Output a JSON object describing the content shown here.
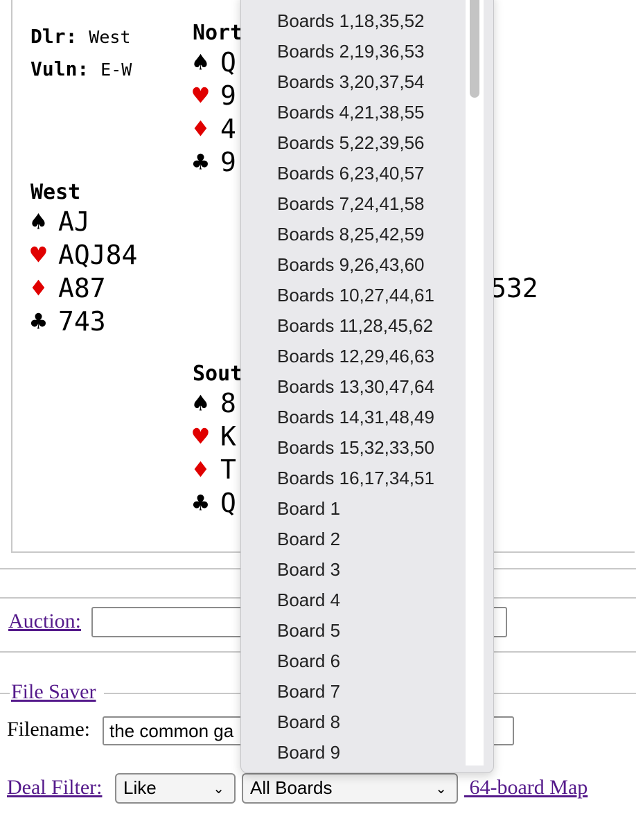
{
  "deal": {
    "dealer_label": "Dlr:",
    "dealer_value": "West",
    "vuln_label": "Vuln:",
    "vuln_value": "E-W",
    "north": {
      "name": "Nort",
      "spades": "Q",
      "hearts": "9",
      "diamonds": "4",
      "clubs": "9"
    },
    "west": {
      "name": "West",
      "spades": "AJ",
      "hearts": "AQJ84",
      "diamonds": "A87",
      "clubs": "743"
    },
    "south": {
      "name": "Sout",
      "spades": "8",
      "hearts": "K",
      "diamonds": "T",
      "clubs": "Q"
    },
    "east_partial": "532",
    "suit_symbols": {
      "spades": "♠",
      "hearts": "♥",
      "diamonds": "♦",
      "clubs": "♣"
    }
  },
  "auction": {
    "label": "Auction:",
    "value": ""
  },
  "file_saver": {
    "legend": "File Saver",
    "filename_label": "Filename:",
    "filename_value": "the common ga"
  },
  "deal_filter": {
    "label": "Deal Filter:",
    "like_value": "Like",
    "boards_value": "All Boards",
    "map_link": "64-board Map"
  },
  "dropdown_options": [
    "Boards 1,18,35,52",
    "Boards 2,19,36,53",
    "Boards 3,20,37,54",
    "Boards 4,21,38,55",
    "Boards 5,22,39,56",
    "Boards 6,23,40,57",
    "Boards 7,24,41,58",
    "Boards 8,25,42,59",
    "Boards 9,26,43,60",
    "Boards 10,27,44,61",
    "Boards 11,28,45,62",
    "Boards 12,29,46,63",
    "Boards 13,30,47,64",
    "Boards 14,31,48,49",
    "Boards 15,32,33,50",
    "Boards 16,17,34,51",
    "Board 1",
    "Board 2",
    "Board 3",
    "Board 4",
    "Board 5",
    "Board 6",
    "Board 7",
    "Board 8",
    "Board 9"
  ],
  "colors": {
    "red_suit": "#e00000",
    "link": "#551a8b",
    "dropdown_bg": "#e9e9ec"
  }
}
